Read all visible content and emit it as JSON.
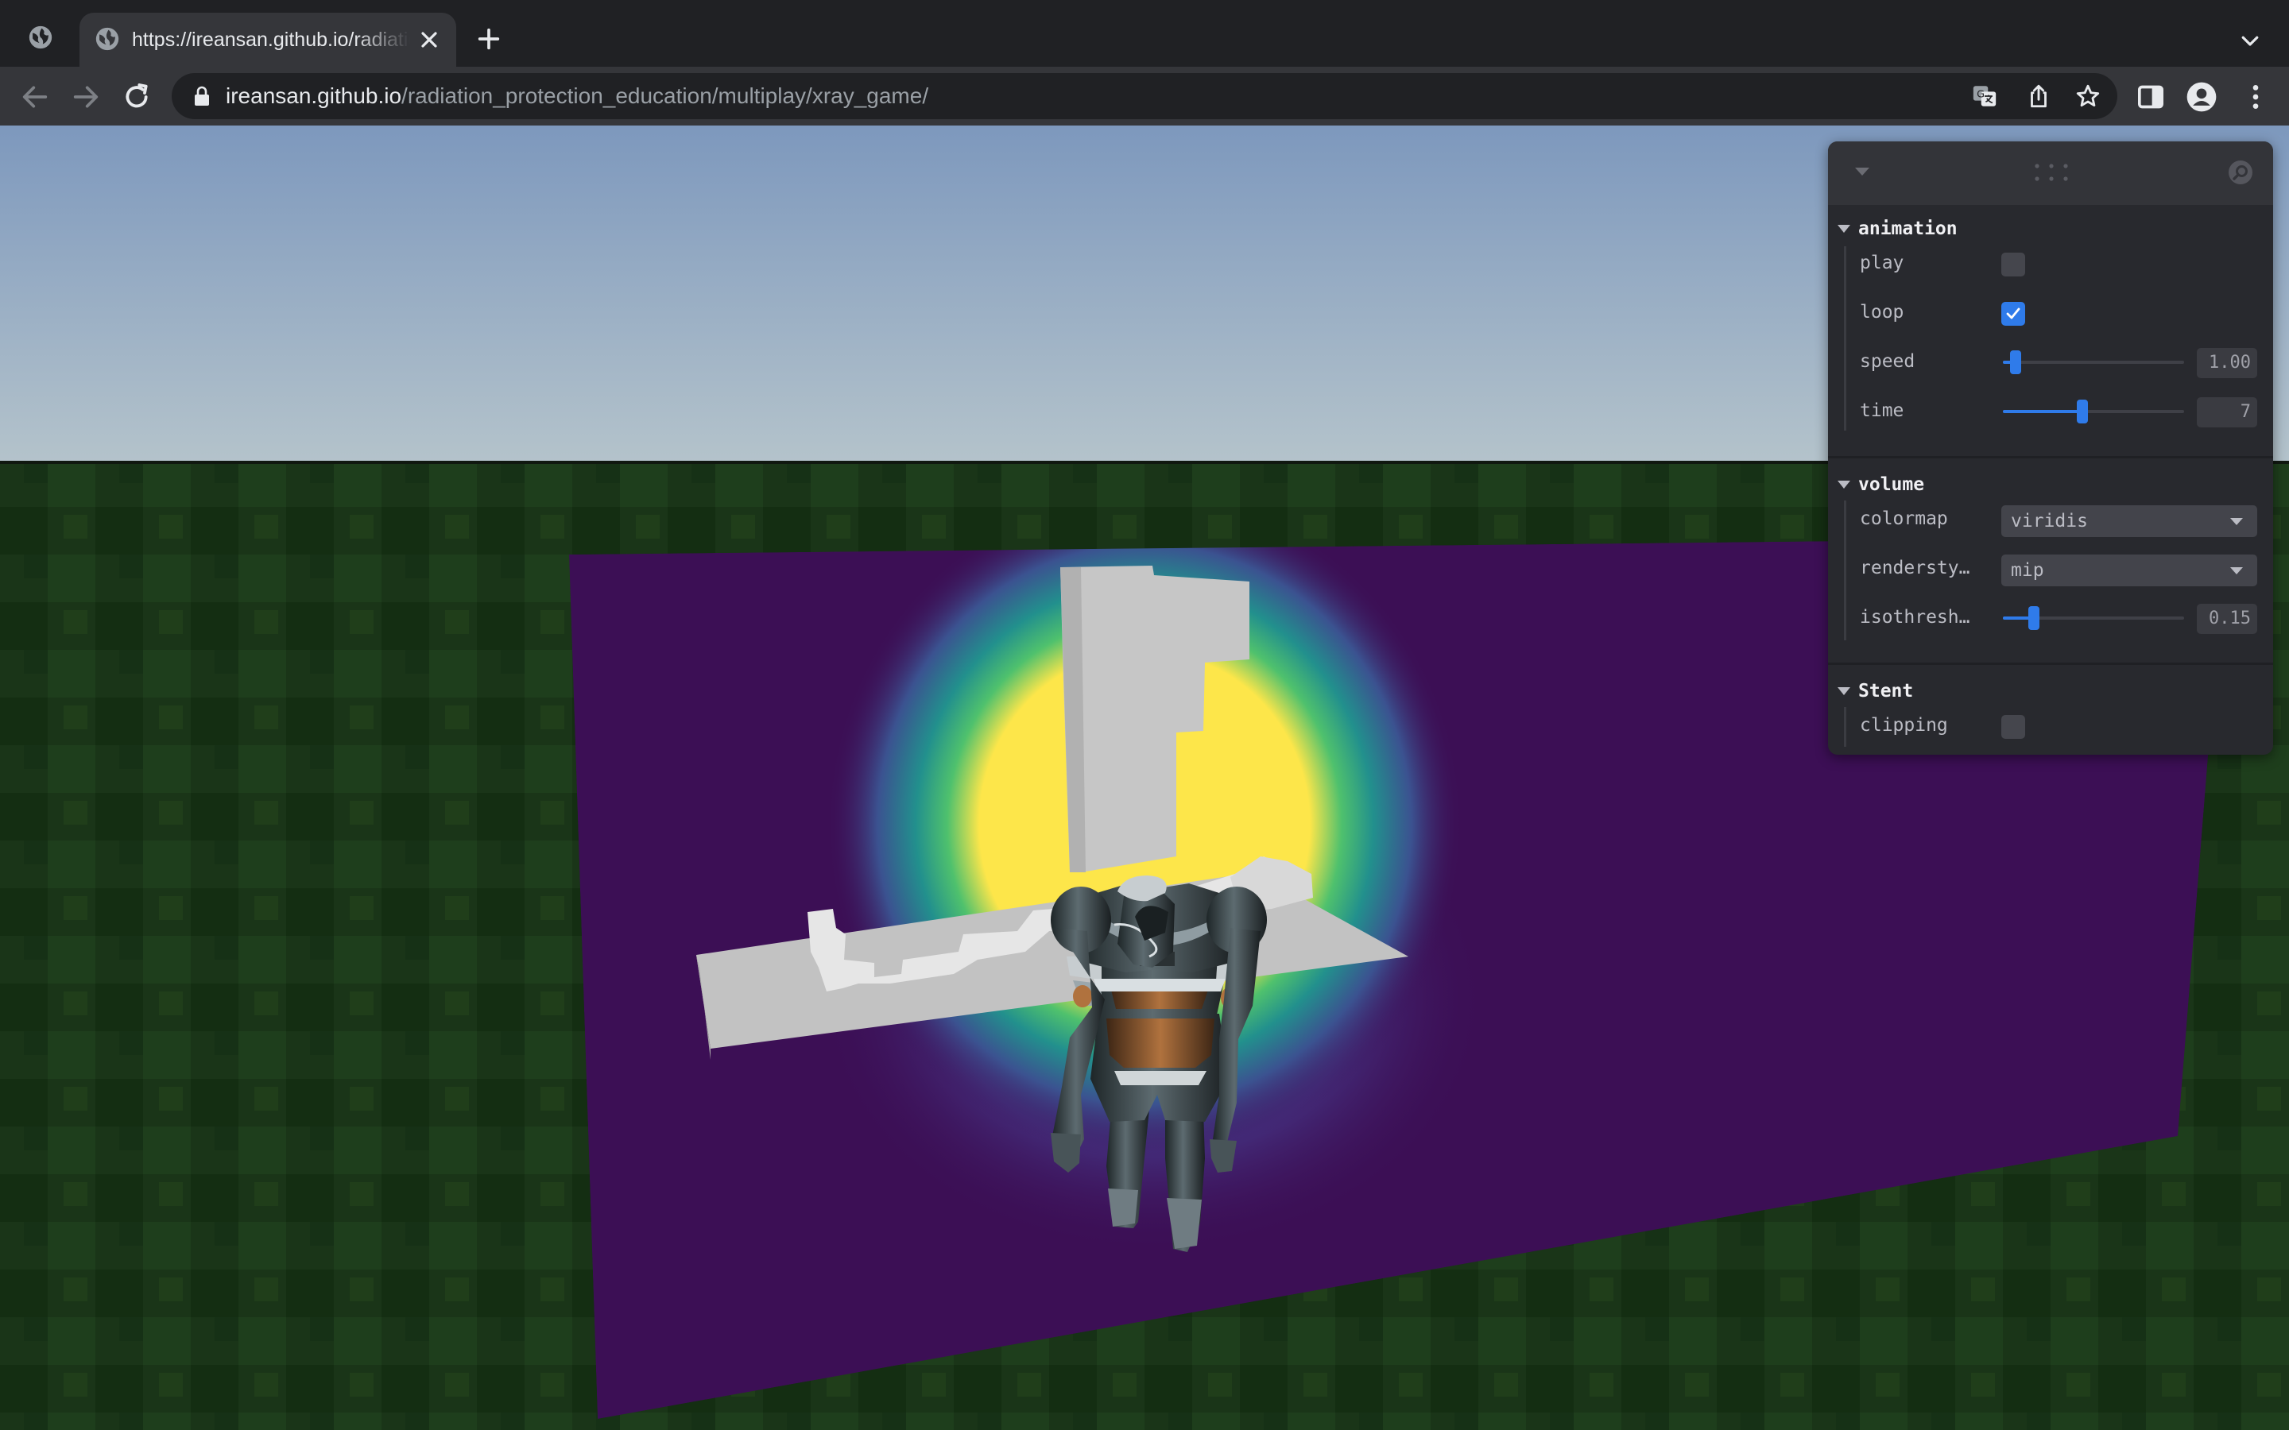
{
  "browser": {
    "tab": {
      "title": "https://ireansan.github.io/radiation_protection_education/multiplay/xray_game/"
    },
    "address": {
      "host": "ireansan.github.io",
      "path": "/radiation_protection_education/multiplay/xray_game/"
    }
  },
  "icons": {
    "inactive_tab": "globe-icon",
    "active_tab": "globe-icon",
    "close": "close-icon",
    "new_tab": "plus-icon",
    "tab_list": "chevron-down-icon",
    "back": "arrow-left-icon",
    "forward": "arrow-right-icon",
    "reload": "reload-icon",
    "lock": "lock-icon",
    "translate": "translate-icon",
    "share": "share-icon",
    "bookmark": "star-icon",
    "side_panel": "side-panel-icon",
    "profile": "profile-icon",
    "menu": "kebab-menu-icon"
  },
  "pane": {
    "folders": [
      {
        "title": "animation",
        "rows": {
          "play": {
            "label": "play",
            "checked": false
          },
          "loop": {
            "label": "loop",
            "checked": true
          },
          "speed": {
            "label": "speed",
            "value": "1.00",
            "fraction": 0.07
          },
          "time": {
            "label": "time",
            "value": "7",
            "fraction": 0.44
          }
        }
      },
      {
        "title": "volume",
        "rows": {
          "colormap": {
            "label": "colormap",
            "value": "viridis"
          },
          "renderstyle": {
            "label": "rendersty…",
            "value": "mip"
          },
          "isothreshold": {
            "label": "isothresh…",
            "value": "0.15",
            "fraction": 0.17
          }
        }
      },
      {
        "title": "Stent",
        "rows": {
          "clipping": {
            "label": "clipping",
            "checked": false
          }
        }
      }
    ]
  },
  "colors": {
    "accent": "#2f7bea",
    "volume_background": "#3c0f55",
    "volume_hot": "#fde64a",
    "sky_top": "#7d98bd",
    "ground": "#1f3d1c"
  }
}
